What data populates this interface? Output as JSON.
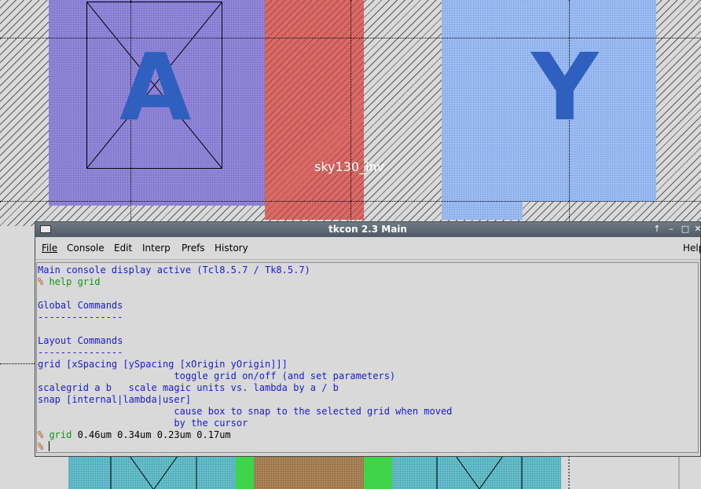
{
  "layout": {
    "cell_label": "sky130_inv",
    "pin_labels": [
      "A",
      "Y"
    ]
  },
  "window": {
    "title": "tkcon 2.3 Main",
    "controls": [
      "↑",
      "–",
      "□",
      "✕"
    ]
  },
  "menubar": {
    "items": [
      "File",
      "Console",
      "Edit",
      "Interp",
      "Prefs",
      "History"
    ],
    "help": "Help"
  },
  "console": {
    "lines": [
      {
        "prompt": "",
        "text": "Main console display active (Tcl8.5.7 / Tk8.5.7)",
        "color": "blue"
      },
      {
        "prompt": "% ",
        "text": "help grid",
        "color": "green"
      },
      {
        "prompt": "",
        "text": "",
        "color": "blue"
      },
      {
        "prompt": "",
        "text": "Global Commands",
        "color": "blue"
      },
      {
        "prompt": "",
        "text": "---------------",
        "color": "blue"
      },
      {
        "prompt": "",
        "text": "",
        "color": "blue"
      },
      {
        "prompt": "",
        "text": "Layout Commands",
        "color": "blue"
      },
      {
        "prompt": "",
        "text": "---------------",
        "color": "blue"
      },
      {
        "prompt": "",
        "text": "grid [xSpacing [ySpacing [xOrigin yOrigin]]]",
        "color": "blue"
      },
      {
        "prompt": "",
        "text": "                        toggle grid on/off (and set parameters)",
        "color": "blue"
      },
      {
        "prompt": "",
        "text": "scalegrid a b   scale magic units vs. lambda by a / b",
        "color": "blue"
      },
      {
        "prompt": "",
        "text": "snap [internal|lambda|user]",
        "color": "blue"
      },
      {
        "prompt": "",
        "text": "                        cause box to snap to the selected grid when moved",
        "color": "blue"
      },
      {
        "prompt": "",
        "text": "                        by the cursor",
        "color": "blue"
      }
    ],
    "last_command": {
      "prompt": "% ",
      "cmd": "grid",
      "args": " 0.46um 0.34um 0.23um 0.17um"
    },
    "input_prompt": "% "
  },
  "colors": {
    "console_text": "#1a1ad0",
    "command_text": "#119911",
    "prompt": "#b05a2a",
    "pin_label": "#2f5fbf"
  }
}
